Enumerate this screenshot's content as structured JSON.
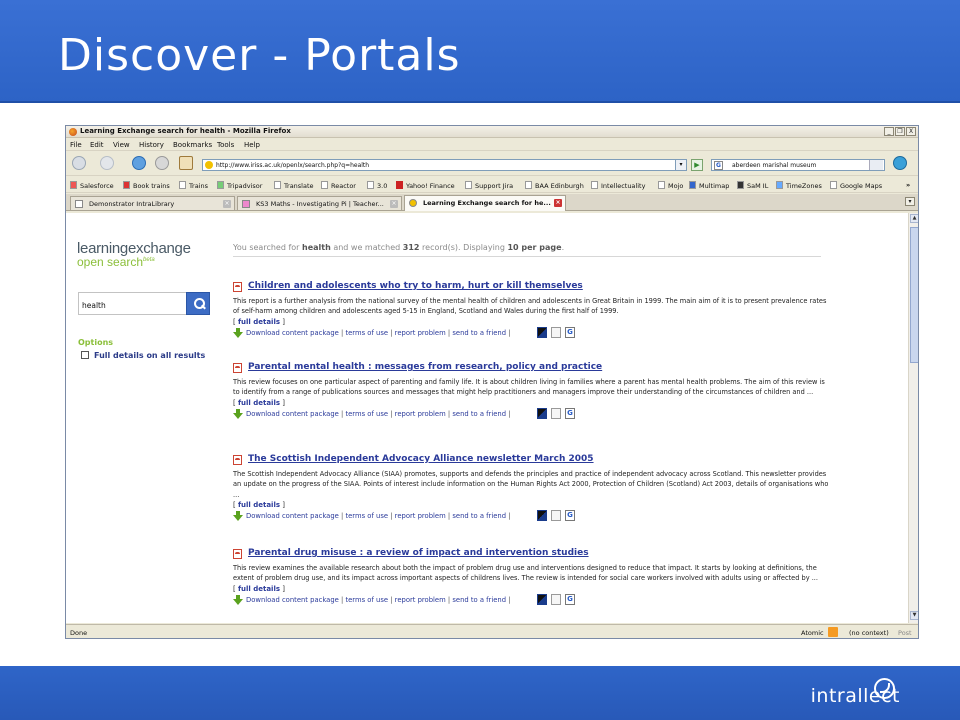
{
  "slide": {
    "title": "Discover - Portals",
    "logo_text": "intrallect"
  },
  "browser": {
    "window_title": "Learning Exchange search for health - Mozilla Firefox",
    "window_buttons": [
      "_",
      "❐",
      "X"
    ],
    "menu": [
      "File",
      "Edit",
      "View",
      "History",
      "Bookmarks",
      "Tools",
      "Help"
    ],
    "url": "http://www.iriss.ac.uk/openlx/search.php?q=health",
    "search_engine": "G",
    "search_value": "aberdeen marishal museum",
    "bookmarks": [
      "Salesforce",
      "Book trains",
      "Trains",
      "Tripadvisor",
      "Translate",
      "Reactor",
      "3.0",
      "Yahoo! Finance",
      "Support Jira",
      "BAA Edinburgh",
      "Intellectuality",
      "Mojo",
      "Multimap",
      "SaM IL",
      "TimeZones",
      "Google Maps",
      "»"
    ],
    "tabs": [
      {
        "label": "Demonstrator IntraLibrary"
      },
      {
        "label": "KS3 Maths - Investigating Pi | Teacher..."
      },
      {
        "label": "Learning Exchange search for he..."
      }
    ],
    "status_left": "Done",
    "status_right": [
      "Atomic",
      "(no context)",
      "Post"
    ]
  },
  "page": {
    "logo_line1": "learningexchange",
    "logo_line2": "open search",
    "logo_beta": "beta",
    "search_value": "health",
    "options_heading": "Options",
    "options_checkbox": "Full details on all results",
    "summary": {
      "prefix": "You searched for ",
      "term": "health",
      "mid": " and we matched ",
      "count": "312",
      "mid2": " record(s). Displaying ",
      "per_page": "10 per page",
      "end": "."
    },
    "full_details_label": "full details",
    "actions": [
      "Download content package",
      "terms of use",
      "report problem",
      "send to a friend"
    ],
    "results": [
      {
        "title": "Children and adolescents who try to harm, hurt or kill themselves",
        "description": "This report is a further analysis from the national survey of the mental health of children and adolescents in Great Britain in 1999. The main aim of it is to present prevalence rates of self-harm among children and adolescents aged 5-15 in England, Scotland and Wales during the first half of 1999."
      },
      {
        "title": "Parental mental health : messages from research, policy and practice",
        "description": "This review focuses on one particular aspect of parenting and family life. It is about children living in families where a parent has mental health problems. The aim of this review is to identify from a range of publications sources and messages that might help practitioners and managers improve their understanding of the circumstances of children and ..."
      },
      {
        "title": "The Scottish Independent Advocacy Alliance newsletter March 2005",
        "description": "The Scottish Independent Advocacy Alliance (SIAA) promotes, supports and defends the principles and practice of independent advocacy across Scotland. This newsletter provides an update on the progress of the SIAA. Points of interest include information on the Human Rights Act 2000, Protection of Children (Scotland) Act 2003, details of organisations who ..."
      },
      {
        "title": "Parental drug misuse : a review of impact and intervention studies",
        "description": "This review examines the available research about both the impact of problem drug use and interventions designed to reduce that impact. It starts by looking at definitions, the extent of problem drug use, and its impact across important aspects of childrens lives. The review is intended for social care workers involved with adults using or affected by ..."
      }
    ]
  }
}
